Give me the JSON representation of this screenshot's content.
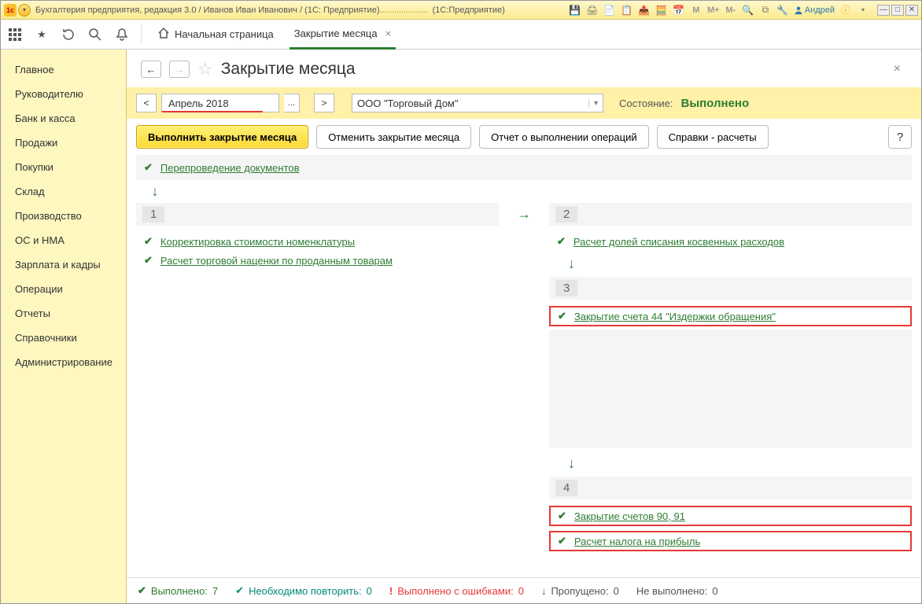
{
  "titlebar": {
    "title": "Бухгалтерия предприятия, редакция 3.0 / Иванов Иван Иванович / (1С: Предприятие)",
    "app": "(1С:Предприятие)",
    "user": "Андрей",
    "m_icons": [
      "M",
      "M+",
      "M-"
    ]
  },
  "toptool": {
    "start_tab": "Начальная страница",
    "active_tab": "Закрытие месяца"
  },
  "sidebar": {
    "items": [
      "Главное",
      "Руководителю",
      "Банк и касса",
      "Продажи",
      "Покупки",
      "Склад",
      "Производство",
      "ОС и НМА",
      "Зарплата и кадры",
      "Операции",
      "Отчеты",
      "Справочники",
      "Администрирование"
    ]
  },
  "page": {
    "title": "Закрытие месяца"
  },
  "controls": {
    "period": "Апрель 2018",
    "org": "ООО \"Торговый Дом\"",
    "status_label": "Состояние:",
    "status_value": "Выполнено"
  },
  "actions": {
    "execute": "Выполнить закрытие месяца",
    "cancel": "Отменить закрытие месяца",
    "report": "Отчет о выполнении операций",
    "references": "Справки - расчеты",
    "help": "?"
  },
  "tasks": {
    "reprovision": "Перепроведение документов",
    "stage1": "1",
    "stage1_tasks": [
      "Корректировка стоимости номенклатуры",
      "Расчет торговой наценки по проданным товарам"
    ],
    "stage2": "2",
    "stage2_tasks": [
      "Расчет долей списания косвенных расходов"
    ],
    "stage3": "3",
    "stage3_tasks": [
      "Закрытие счета 44 \"Издержки обращения\""
    ],
    "stage4": "4",
    "stage4_tasks": [
      "Закрытие счетов 90, 91",
      "Расчет налога на прибыль"
    ]
  },
  "status": {
    "done_label": "Выполнено:",
    "done_count": "7",
    "repeat_label": "Необходимо повторить:",
    "repeat_count": "0",
    "errors_label": "Выполнено с ошибками:",
    "errors_count": "0",
    "skipped_label": "Пропущено:",
    "skipped_count": "0",
    "notdone_label": "Не выполнено:",
    "notdone_count": "0"
  }
}
